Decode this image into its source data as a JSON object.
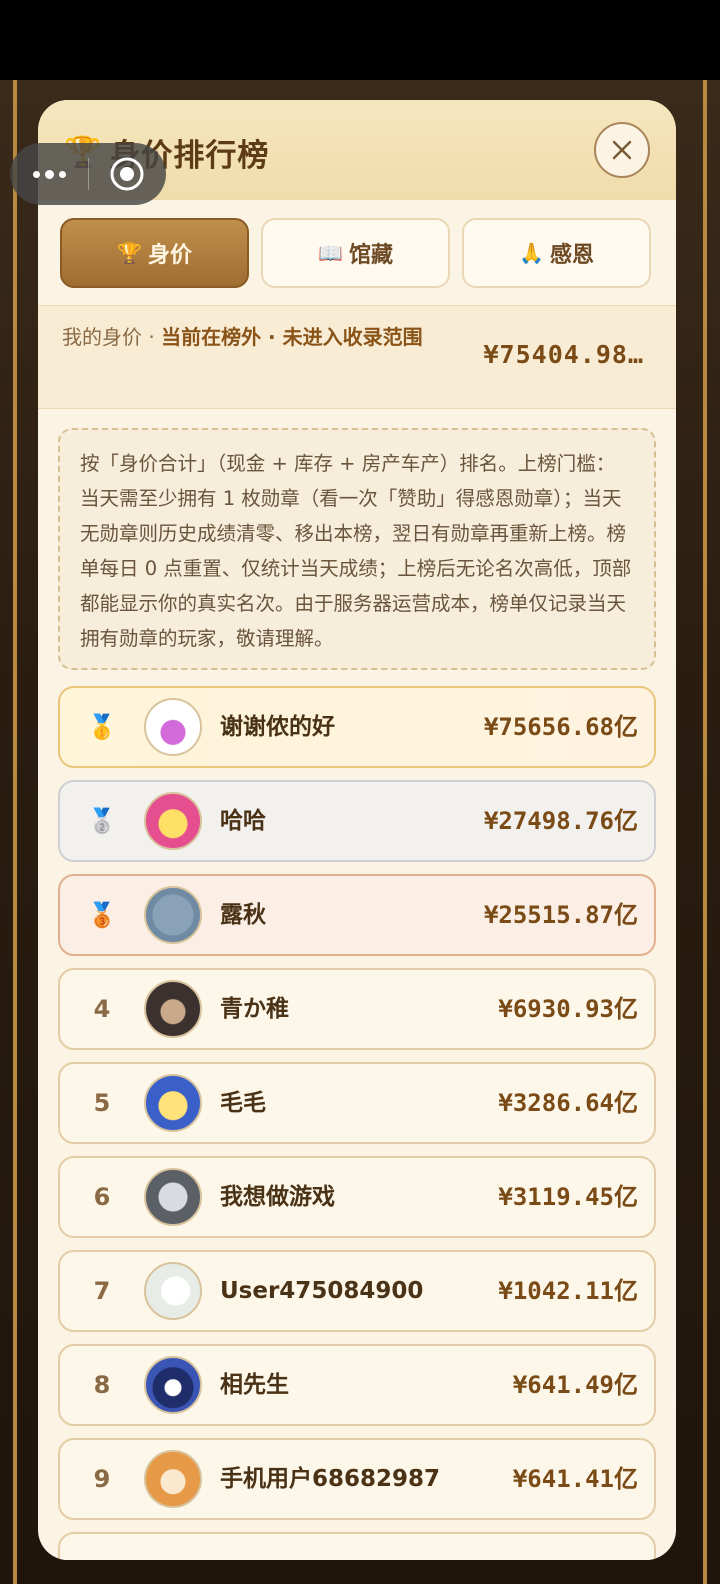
{
  "header": {
    "title": "身价排行榜",
    "trophy_icon": "🏆",
    "close_icon": "close-icon"
  },
  "tabs": [
    {
      "icon": "🏆",
      "label": "身价",
      "active": true
    },
    {
      "icon": "📖",
      "label": "馆藏",
      "active": false
    },
    {
      "icon": "🙏",
      "label": "感恩",
      "active": false
    }
  ],
  "mine": {
    "label": "我的身价 · ",
    "status": "当前在榜外 · 未进入收录范围",
    "value": "¥75404.98…"
  },
  "notice": "按「身价合计」（现金 + 库存 + 房产车产）排名。上榜门槛：当天需至少拥有 1 枚勋章（看一次「赞助」得感恩勋章）；当天无勋章则历史成绩清零、移出本榜，翌日有勋章再重新上榜。榜单每日 0 点重置、仅统计当天成绩；上榜后无论名次高低，顶部都能显示你的真实名次。由于服务器运营成本，榜单仅记录当天拥有勋章的玩家，敬请理解。",
  "ranking": [
    {
      "rank": "🥇",
      "name": "谢谢侬的好",
      "value": "¥75656.68亿"
    },
    {
      "rank": "🥈",
      "name": "哈哈",
      "value": "¥27498.76亿"
    },
    {
      "rank": "🥉",
      "name": "露秋",
      "value": "¥25515.87亿"
    },
    {
      "rank": "4",
      "name": "青か稚",
      "value": "¥6930.93亿"
    },
    {
      "rank": "5",
      "name": "毛毛",
      "value": "¥3286.64亿"
    },
    {
      "rank": "6",
      "name": "我想做游戏",
      "value": "¥3119.45亿"
    },
    {
      "rank": "7",
      "name": "User475084900",
      "value": "¥1042.11亿"
    },
    {
      "rank": "8",
      "name": "相先生",
      "value": "¥641.49亿"
    },
    {
      "rank": "9",
      "name": "手机用户68682987",
      "value": "¥641.41亿"
    }
  ],
  "colors": {
    "accent": "#9f6d30",
    "gold": "#e8c77a",
    "text": "#4a3216"
  }
}
